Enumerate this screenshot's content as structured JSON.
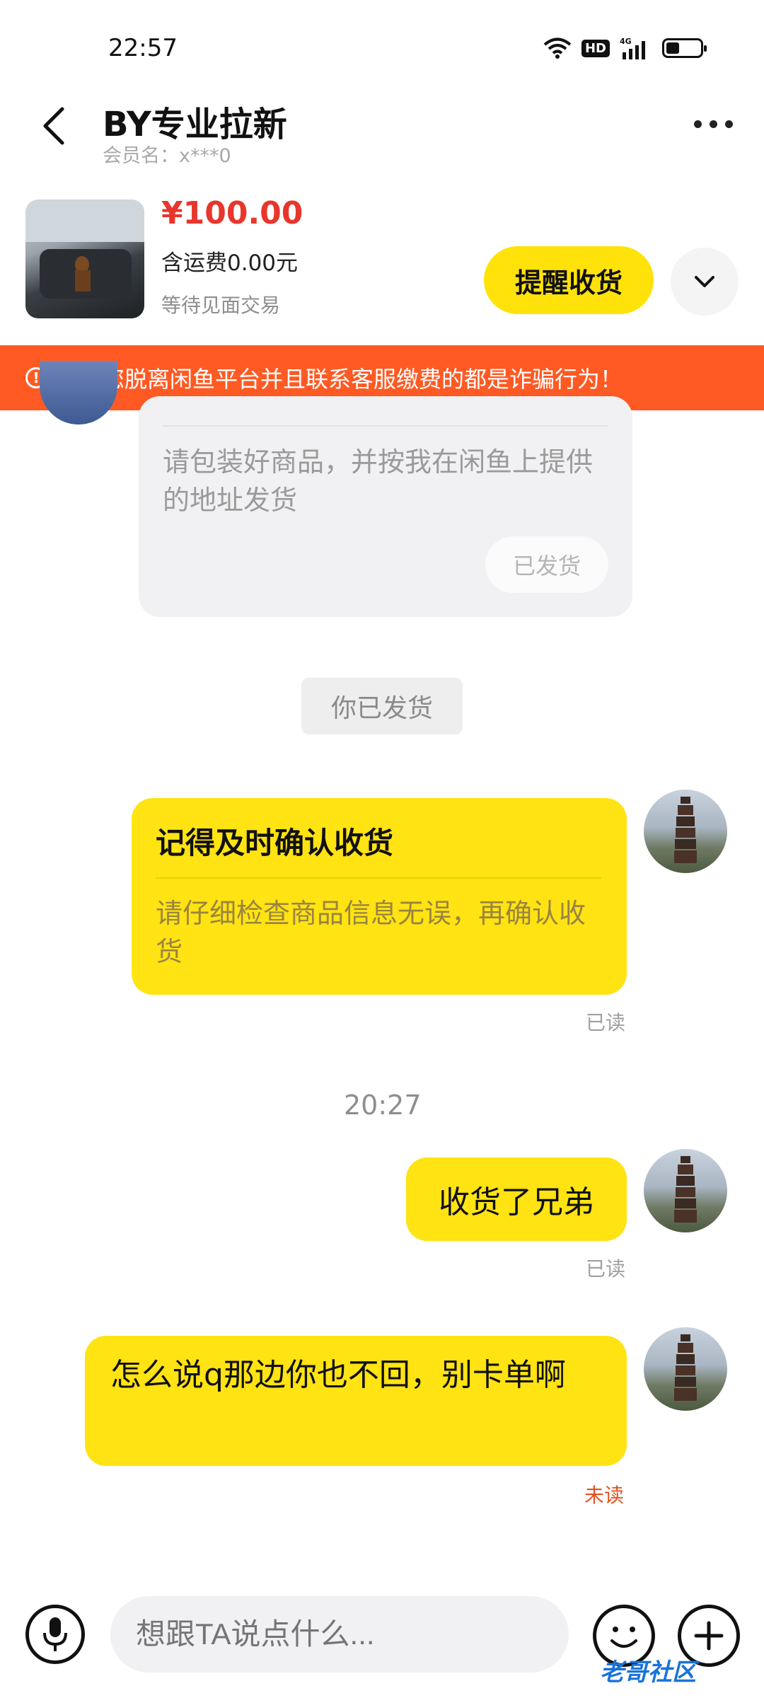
{
  "status_bar": {
    "time": "22:57",
    "network": "4G",
    "hd": "HD",
    "battery_level": 0.4
  },
  "header": {
    "title": "BY专业拉新",
    "member": "会员名：x***0"
  },
  "product": {
    "price": "¥100.00",
    "shipping": "含运费0.00元",
    "status": "等待见面交易",
    "remind_label": "提醒收货"
  },
  "warning": {
    "text": "引导您脱离闲鱼平台并且联系客服缴费的都是诈骗行为！"
  },
  "messages": {
    "ship_card": {
      "body": "请包装好商品，并按我在闲鱼上提供的地址发货",
      "button": "已发货"
    },
    "system_notice": "你已发货",
    "confirm_card": {
      "title": "记得及时确认收货",
      "body": "请仔细检查商品信息无误，再确认收货",
      "read": "已读"
    },
    "timestamp": "20:27",
    "msg1": {
      "text": "收货了兄弟",
      "read": "已读"
    },
    "msg2": {
      "text": "怎么说q那边你也不回，别卡单啊",
      "read": "未读"
    }
  },
  "input": {
    "placeholder": "想跟TA说点什么..."
  },
  "watermark": "老哥社区",
  "colors": {
    "accent_yellow": "#ffe312",
    "price_red": "#e8362d",
    "warning_orange": "#ff5a24",
    "unread_red": "#e3521f"
  }
}
